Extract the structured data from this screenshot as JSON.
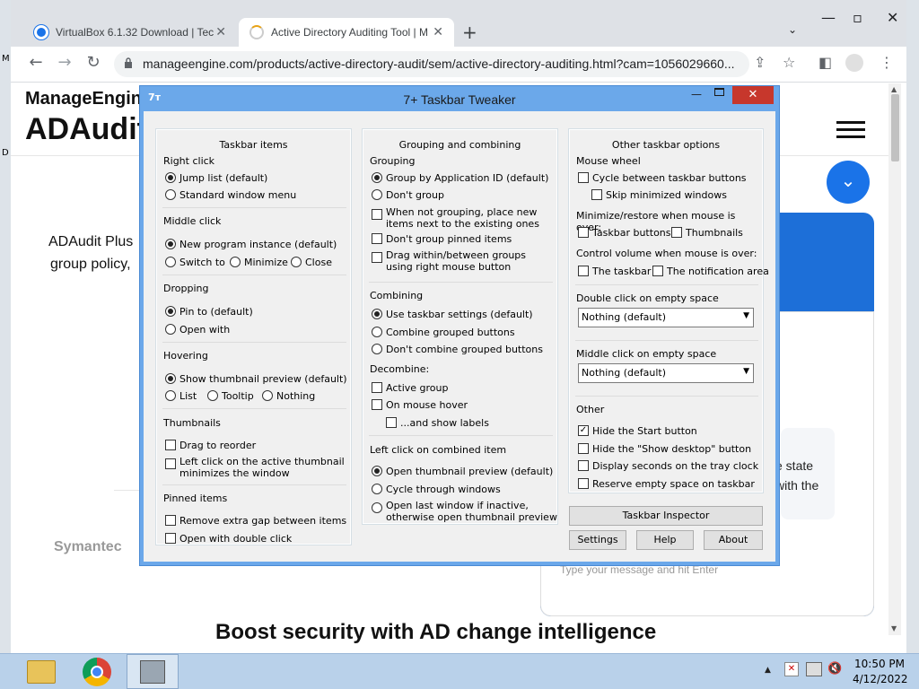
{
  "browser": {
    "tabs": [
      {
        "title": "VirtualBox 6.1.32 Download | Tec",
        "close": "✕"
      },
      {
        "title": "Active Directory Auditing Tool | M",
        "close": "✕"
      }
    ],
    "new_tab": "+",
    "url": "manageengine.com/products/active-directory-audit/sem/active-directory-auditing.html?cam=1056029660..."
  },
  "page": {
    "brand": "ManageEngine",
    "product": "ADAudit",
    "intro_line1": "ADAudit Plus",
    "intro_line2": "group policy,",
    "right_text1": "e state",
    "right_text2": "with the",
    "chat_placeholder": "Type your message and hit Enter",
    "symantec": "Symantec",
    "headline": "Boost security with AD change intelligence"
  },
  "window": {
    "title": "7+ Taskbar Tweaker",
    "col1": {
      "title": "Taskbar items",
      "right_click": "Right click",
      "jump_list": "Jump list (default)",
      "standard_menu": "Standard window menu",
      "middle_click": "Middle click",
      "new_instance": "New program instance (default)",
      "switch_to": "Switch to",
      "minimize": "Minimize",
      "close": "Close",
      "dropping": "Dropping",
      "pin_to": "Pin to (default)",
      "open_with": "Open with",
      "hovering": "Hovering",
      "show_thumb": "Show thumbnail preview (default)",
      "list": "List",
      "tooltip": "Tooltip",
      "nothing": "Nothing",
      "thumbnails": "Thumbnails",
      "drag_reorder": "Drag to reorder",
      "left_click_thumb1": "Left click on the active thumbnail",
      "left_click_thumb2": "minimizes the window",
      "pinned": "Pinned items",
      "remove_gap": "Remove extra gap between items",
      "open_double": "Open with double click"
    },
    "col2": {
      "title": "Grouping and combining",
      "grouping": "Grouping",
      "group_by_id": "Group by Application ID (default)",
      "dont_group": "Don't group",
      "not_grouping1": "When not grouping, place new",
      "not_grouping2": "items next to the existing ones",
      "dont_group_pinned": "Don't group pinned items",
      "drag_within1": "Drag within/between groups",
      "drag_within2": "using right mouse button",
      "combining": "Combining",
      "use_taskbar": "Use taskbar settings (default)",
      "combine_grouped": "Combine grouped buttons",
      "dont_combine": "Don't combine grouped buttons",
      "decombine": "Decombine:",
      "active_group": "Active group",
      "on_hover": "On mouse hover",
      "show_labels": "...and show labels",
      "left_click_combined": "Left click on combined item",
      "open_thumb": "Open thumbnail preview (default)",
      "cycle": "Cycle through windows",
      "open_last1": "Open last window if inactive,",
      "open_last2": "otherwise open thumbnail preview"
    },
    "col3": {
      "title": "Other taskbar options",
      "mouse_wheel": "Mouse wheel",
      "cycle_buttons": "Cycle between taskbar buttons",
      "skip_min": "Skip minimized windows",
      "minrestore": "Minimize/restore when mouse is over:",
      "taskbar_buttons": "Taskbar buttons",
      "thumbnails": "Thumbnails",
      "control_volume": "Control volume when mouse is over:",
      "the_taskbar": "The taskbar",
      "notif_area": "The notification area",
      "double_click": "Double click on empty space",
      "double_value": "Nothing (default)",
      "middle_click": "Middle click on empty space",
      "middle_value": "Nothing (default)",
      "other": "Other",
      "hide_start": "Hide the Start button",
      "hide_desktop": "Hide the \"Show desktop\" button",
      "display_seconds": "Display seconds on the tray clock",
      "reserve": "Reserve empty space on taskbar"
    },
    "buttons": {
      "inspector": "Taskbar Inspector",
      "settings": "Settings",
      "help": "Help",
      "about": "About"
    }
  },
  "taskbar": {
    "time": "10:50 PM",
    "date": "4/12/2022"
  }
}
